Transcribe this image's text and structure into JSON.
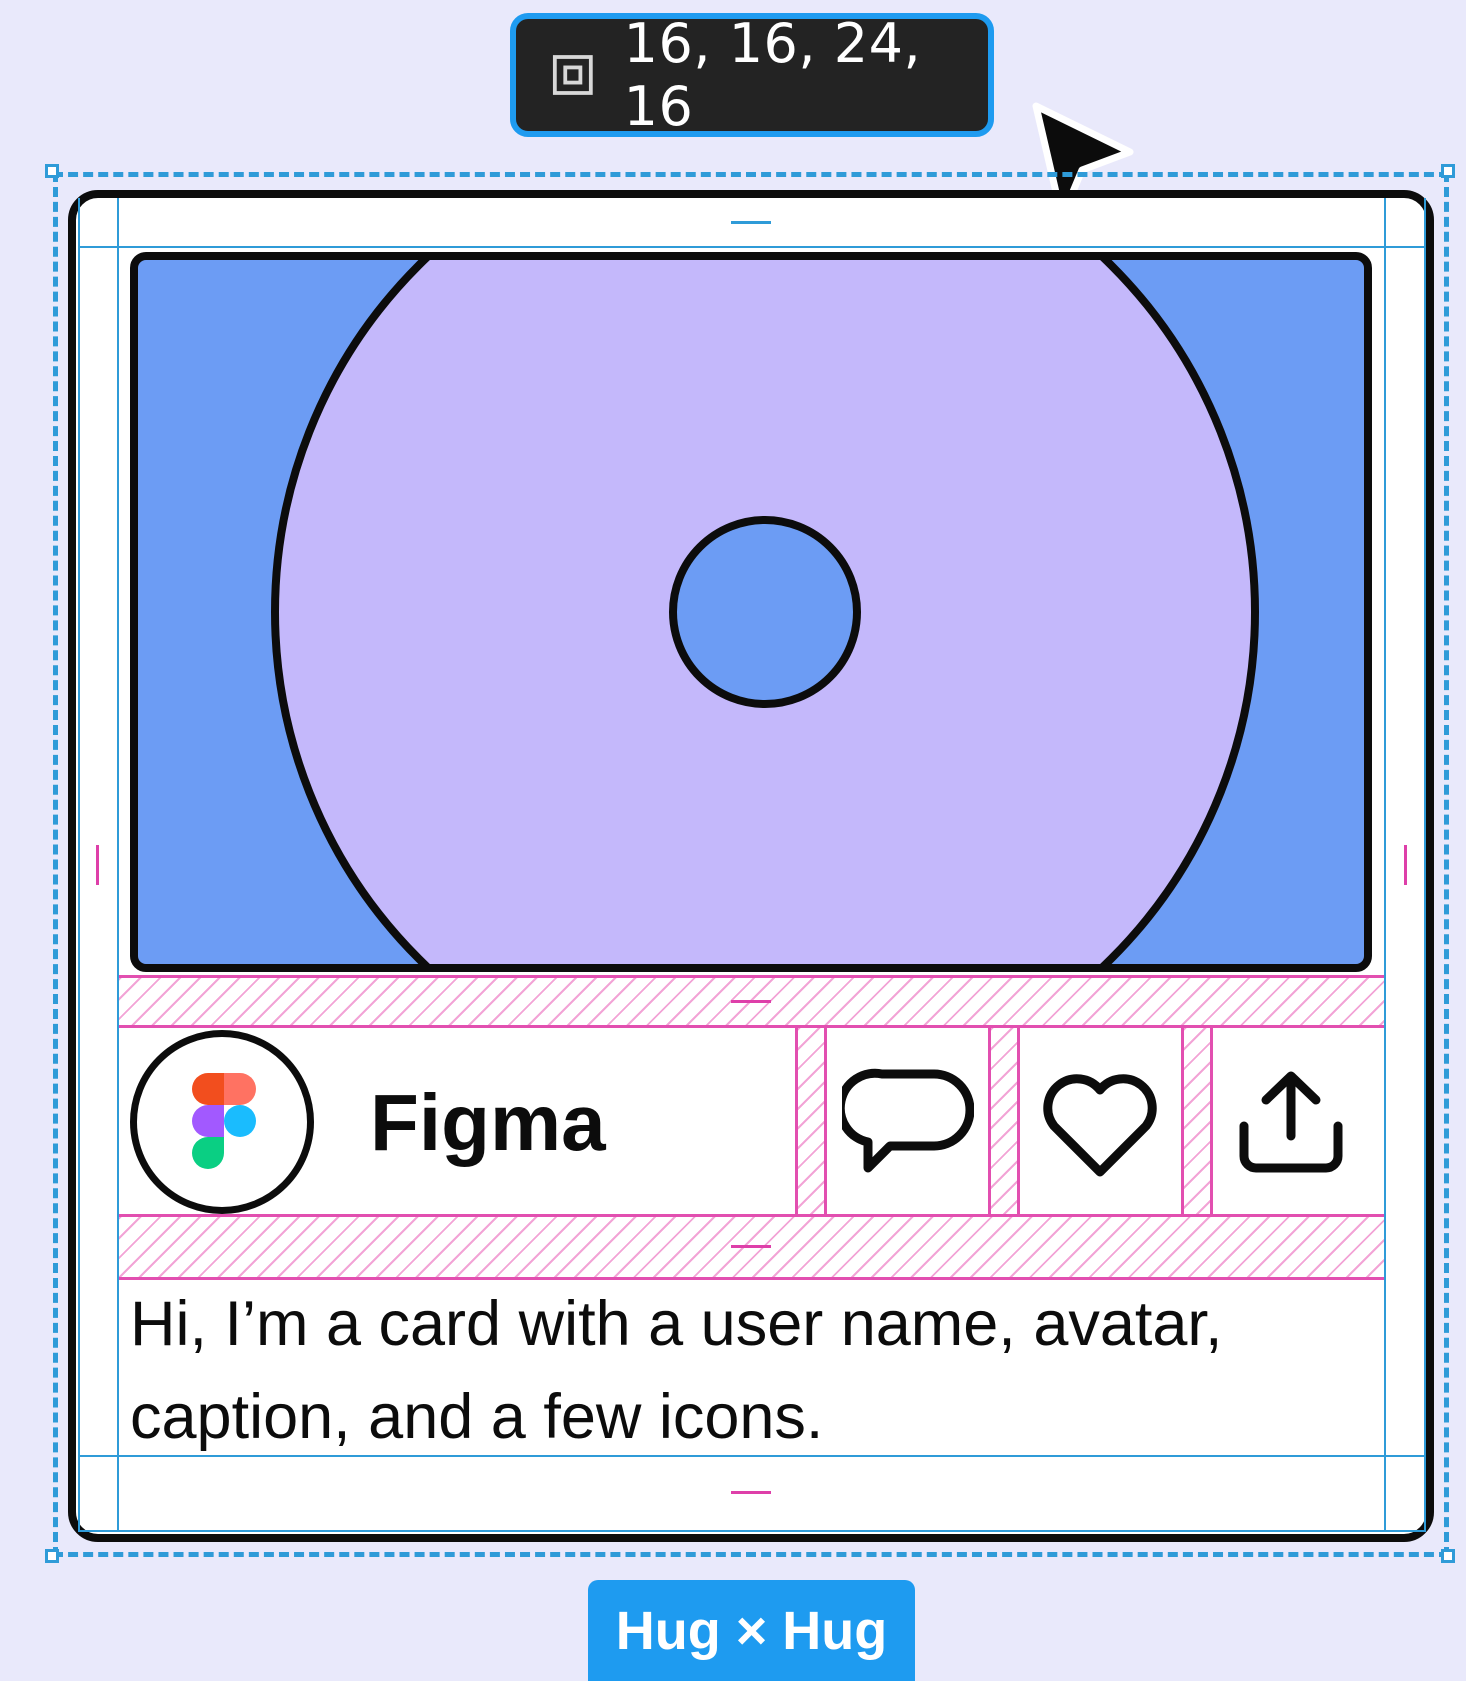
{
  "tooltip": {
    "padding_text": "16, 16, 24, 16",
    "icon": "padding-icon"
  },
  "card": {
    "user_name": "Figma",
    "caption": "Hi, I’m a card with a user name, avatar, caption, and a few icons.",
    "icons": [
      "comment-icon",
      "heart-icon",
      "share-icon"
    ],
    "avatar_icon": "figma-logo"
  },
  "size_badge": {
    "label": "Hug × Hug"
  },
  "colors": {
    "canvas": "#e9e9fb",
    "selection": "#2f9bd8",
    "hero_bg": "#6c9cf4",
    "disc": "#c4b8fb",
    "spacing": "#e24fb0"
  }
}
